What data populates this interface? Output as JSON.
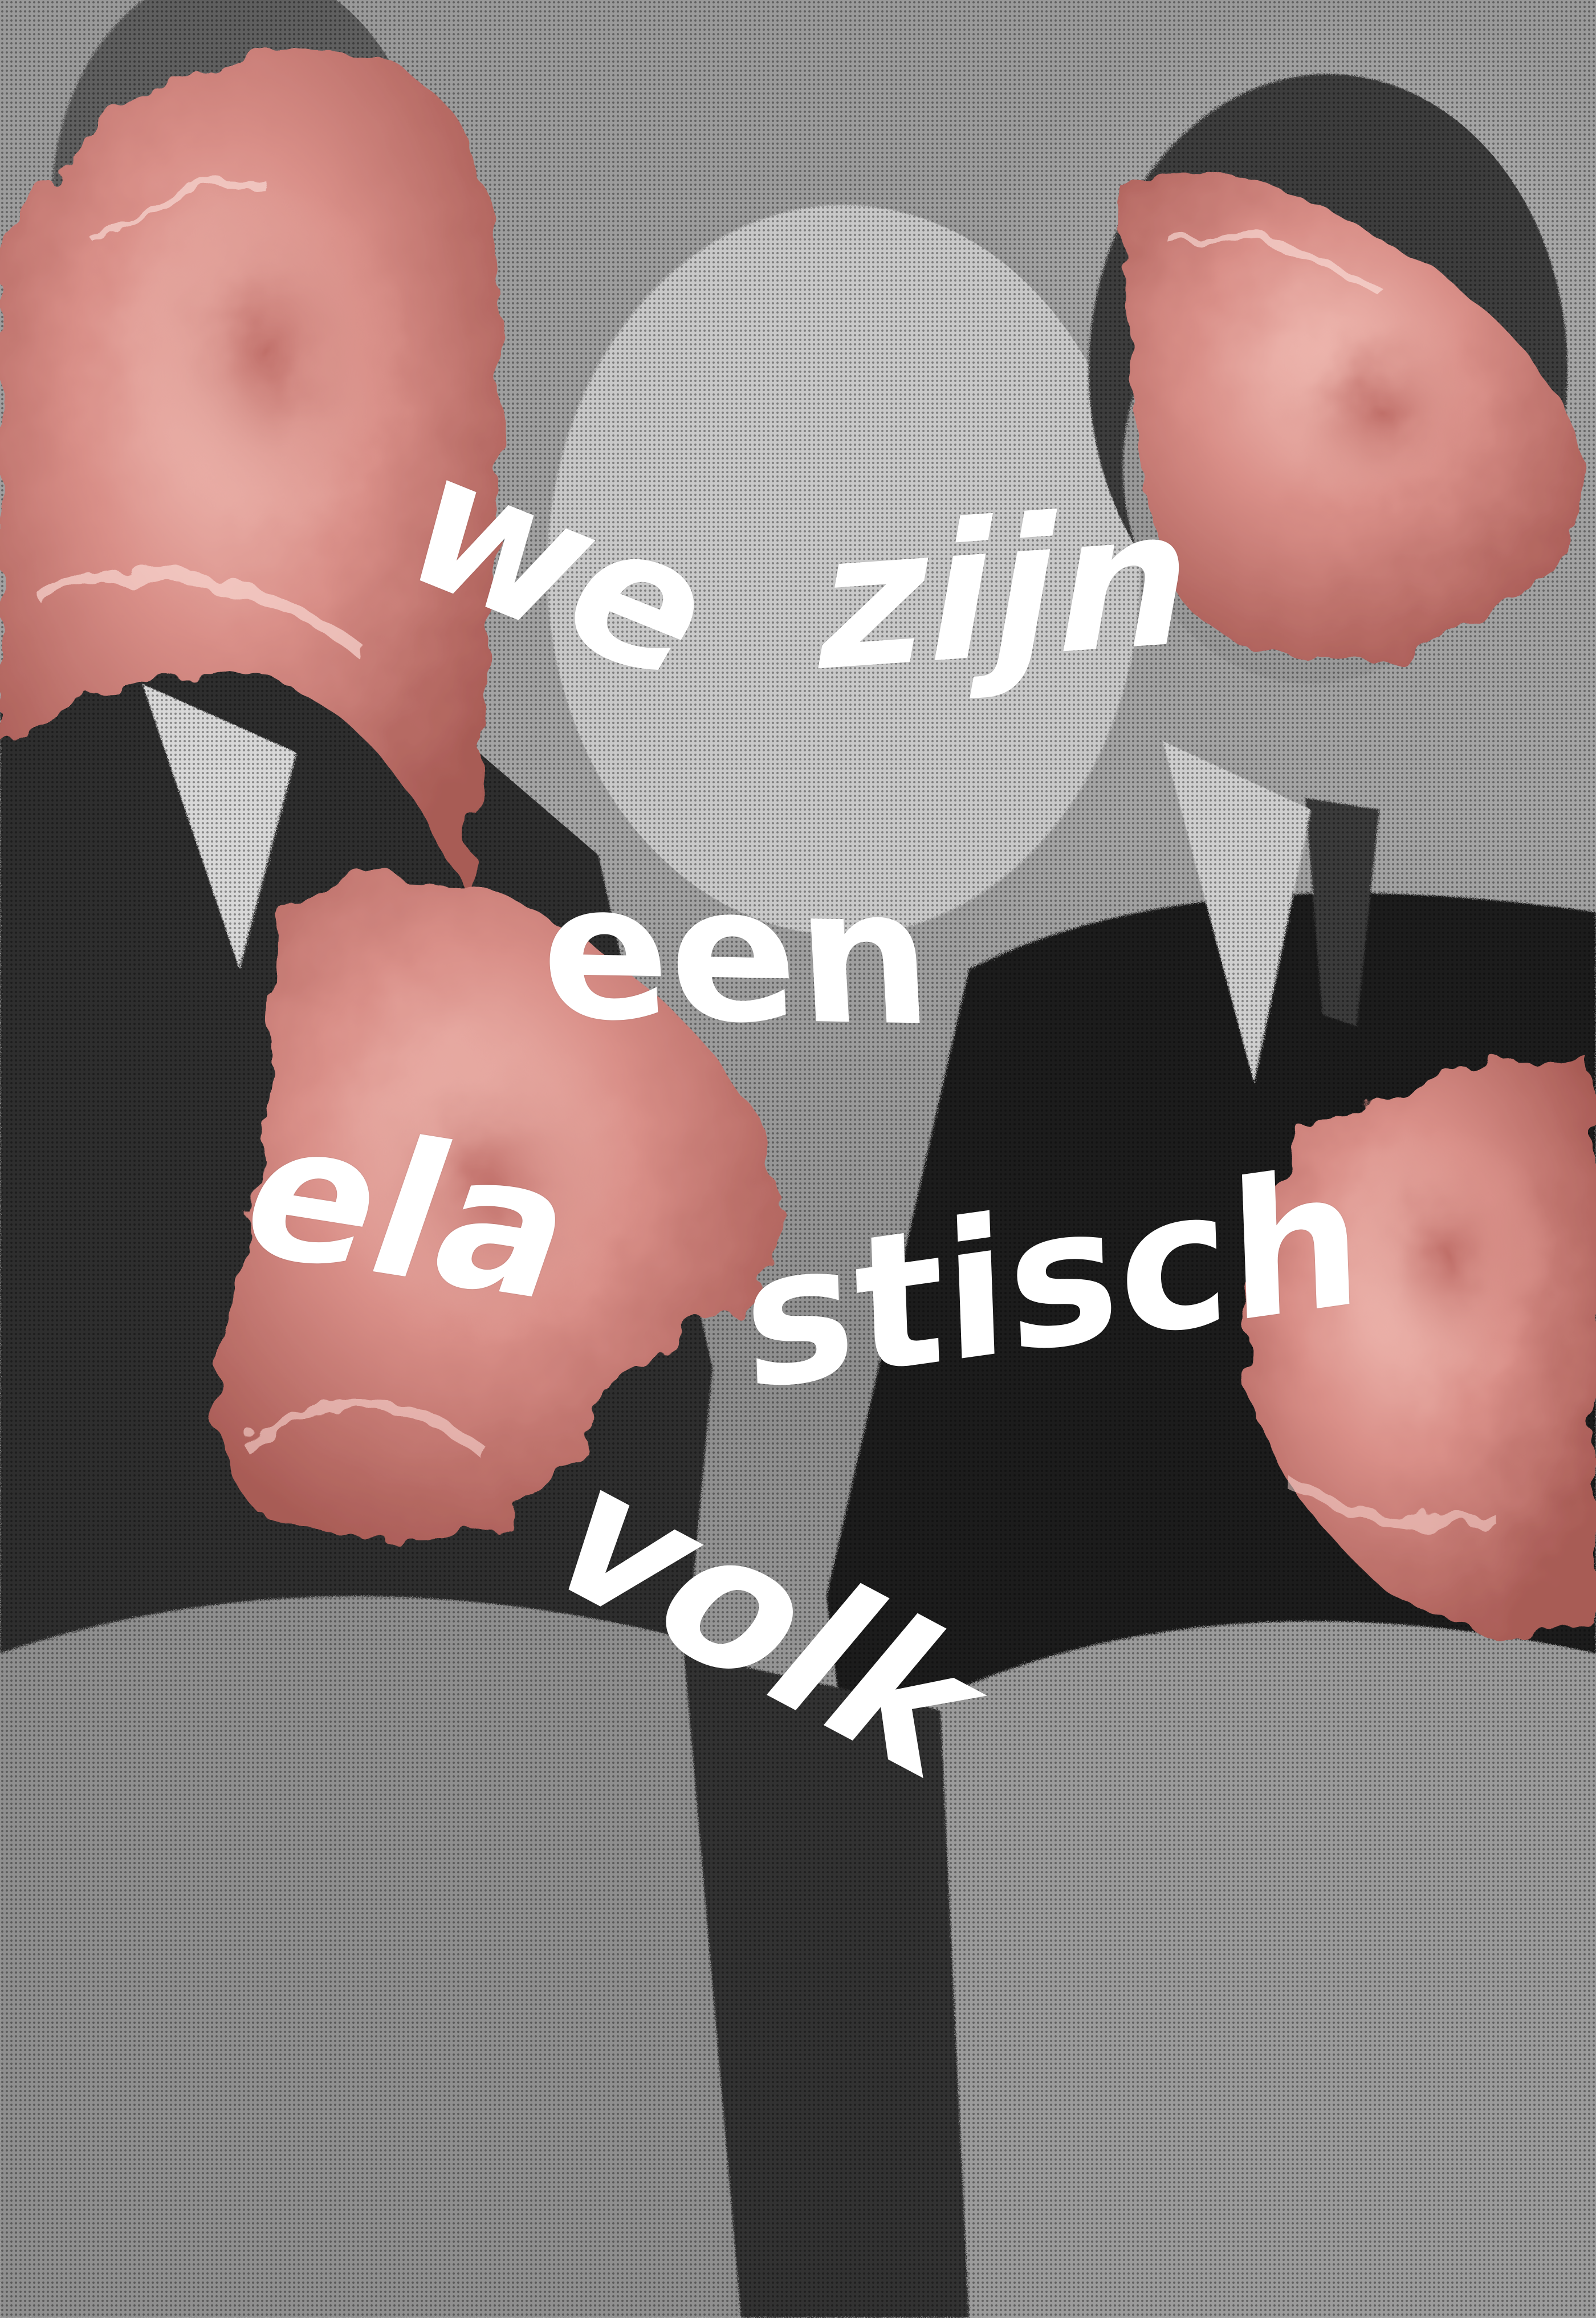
{
  "poster": {
    "headline": {
      "line1_word1": "we",
      "line1_word2": "zijn",
      "line2": "een",
      "line3_part1": "ela",
      "line3_part2": "stisch",
      "line4": "volk"
    }
  },
  "colors": {
    "photo_light": "#d0d0d0",
    "photo_dark": "#2a2a2a",
    "flesh_base": "#d68f88",
    "flesh_highlight": "#f6c8c1",
    "flesh_shadow": "#a85a55",
    "text": "#ffffff"
  }
}
